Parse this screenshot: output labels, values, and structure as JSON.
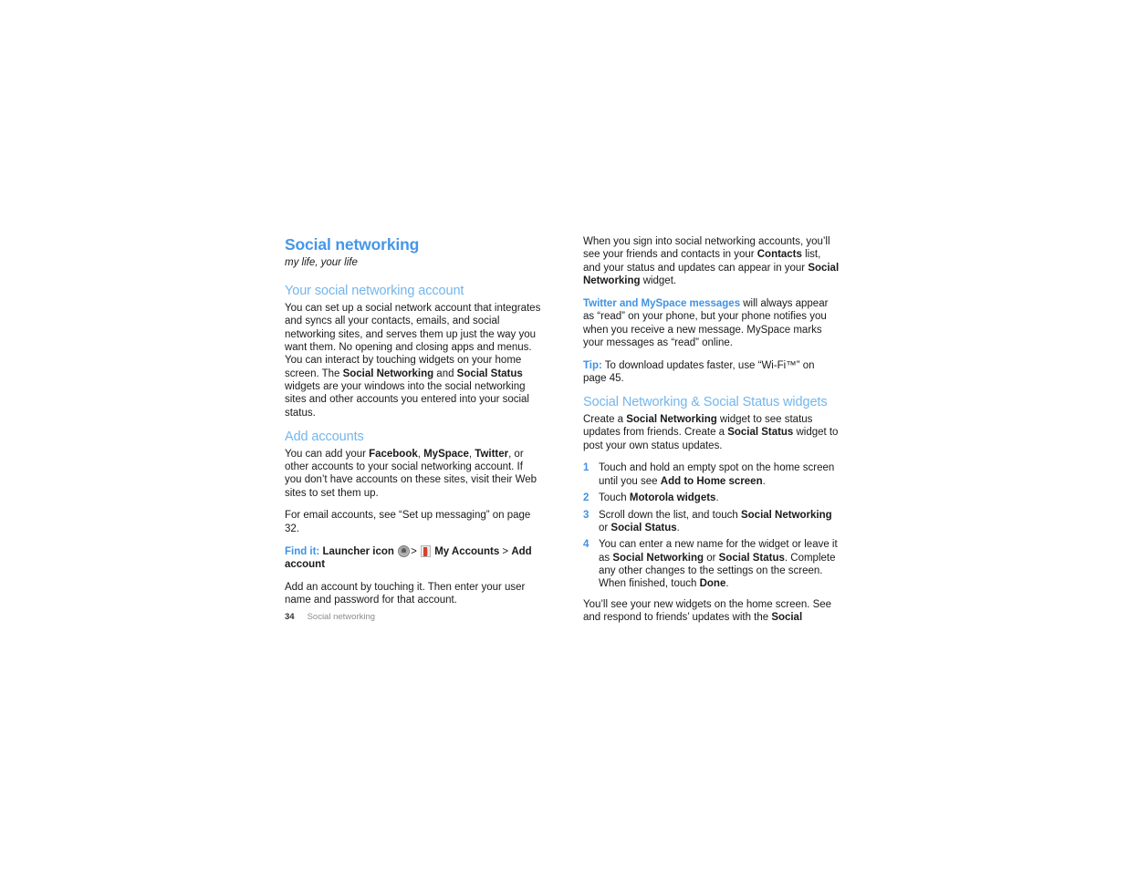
{
  "page": {
    "chapter_title": "Social networking",
    "tagline": "my life, your life",
    "footer_page_number": "34",
    "footer_title": "Social networking",
    "accent_blue": "#4596e8",
    "heading_blue": "#73b6ec",
    "body_color": "#1a1a1a"
  },
  "left_column": {
    "section1": {
      "heading": "Your social networking account",
      "para1_a": "You can set up a social network account that integrates and syncs all your contacts, emails, and social networking sites, and serves them up just the way you want them. No opening and closing apps and menus. You can interact by touching widgets on your home screen. The ",
      "para1_b1": "Social Networking",
      "para1_c": " and ",
      "para1_b2": "Social Status",
      "para1_d": " widgets are your windows into the social networking sites and other accounts you entered into your social status."
    },
    "section2": {
      "heading": "Add accounts",
      "para1_a": "You can add your ",
      "para1_b1": "Facebook",
      "para1_sep1": ", ",
      "para1_b2": "MySpace",
      "para1_sep2": ", ",
      "para1_b3": "Twitter",
      "para1_c": ", or other accounts to your social networking account. If you don’t have accounts on these sites, visit their Web sites to set them up.",
      "para2": "For email accounts, see “Set up messaging” on page 32.",
      "finditbar": {
        "label": "Find it:",
        "step1": "Launcher icon",
        "launcher_icon": "launcher-icon",
        "sep1": ">",
        "accounts_icon": "my-accounts-icon",
        "step2": "My Accounts",
        "sep2": ">",
        "step3": "Add account"
      },
      "para3": "Add an account by touching it. Then enter your user name and password for that account."
    }
  },
  "right_column": {
    "intro": {
      "para1_a": "When you sign into social networking accounts, you’ll see your friends and contacts in your ",
      "para1_b1": "Contacts",
      "para1_c": " list, and your status and updates can appear in your ",
      "para1_b2": "Social Networking",
      "para1_d": " widget."
    },
    "note": {
      "runin": "Twitter and MySpace messages",
      "text": " will always appear as “read” on your phone, but your phone notifies you when you receive a new message. MySpace marks your messages as “read” online."
    },
    "tip": {
      "runin": "Tip:",
      "text": " To download updates faster, use “Wi-Fi™” on page 45."
    },
    "widgets_section": {
      "heading": "Social Networking & Social Status widgets",
      "intro_a": "Create a ",
      "intro_b1": "Social Networking",
      "intro_c": " widget to see status updates from friends. Create a ",
      "intro_b2": "Social Status",
      "intro_d": " widget to post your own status updates.",
      "steps": [
        {
          "num": "1",
          "a": "Touch and hold an empty spot on the home screen until you see ",
          "b": "Add to Home screen",
          "c": "."
        },
        {
          "num": "2",
          "a": "Touch ",
          "b": "Motorola widgets",
          "c": "."
        },
        {
          "num": "3",
          "a": "Scroll down the list, and touch ",
          "b": "Social Networking",
          "c": " or ",
          "b2": "Social Status",
          "d": "."
        },
        {
          "num": "4",
          "a": "You can enter a new name for the widget or leave it as ",
          "b": "Social Networking",
          "c": " or ",
          "b2": "Social Status",
          "d": ". Complete any other changes to the settings on the screen. When finished, touch ",
          "b3": "Done",
          "e": "."
        }
      ],
      "closing_a": "You’ll see your new widgets on the home screen. See and respond to friends’ updates with the ",
      "closing_b": "Social"
    }
  }
}
